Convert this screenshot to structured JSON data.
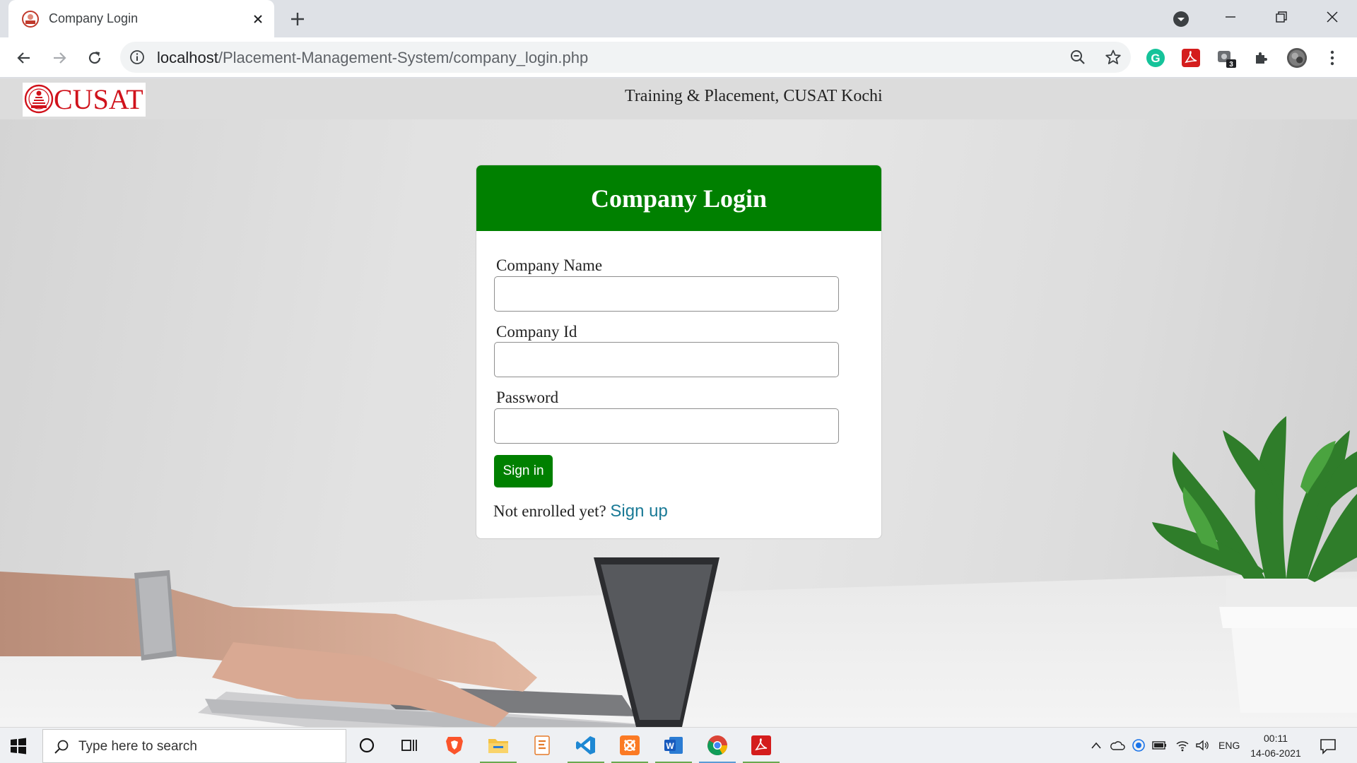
{
  "browser": {
    "tab_title": "Company Login",
    "url_host": "localhost",
    "url_path": "/Placement-Management-System/company_login.php",
    "extension_badge": "3"
  },
  "site": {
    "logo_text": "CUSAT",
    "header_title": "Training & Placement, CUSAT Kochi"
  },
  "login": {
    "title": "Company Login",
    "fields": [
      {
        "label": "Company Name",
        "value": ""
      },
      {
        "label": "Company Id",
        "value": ""
      },
      {
        "label": "Password",
        "value": ""
      }
    ],
    "submit_label": "Sign in",
    "enroll_text": "Not enrolled yet?",
    "signup_label": "Sign up"
  },
  "taskbar": {
    "search_placeholder": "Type here to search",
    "language": "ENG",
    "time": "00:11",
    "date": "14-06-2021"
  },
  "colors": {
    "accent_green": "#008000",
    "signup_link": "#1a7a96",
    "logo_red": "#d0121b"
  }
}
